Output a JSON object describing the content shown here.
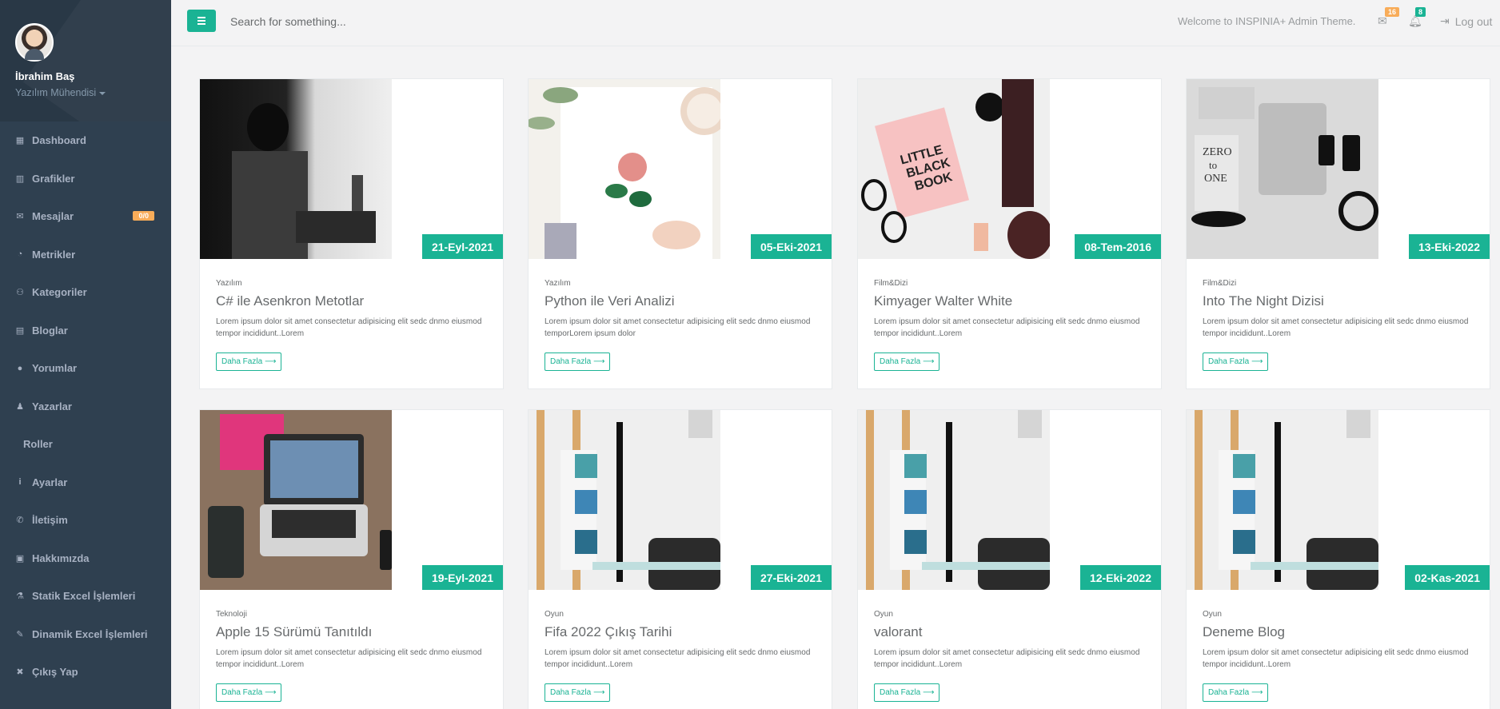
{
  "sidebar": {
    "profile": {
      "name": "İbrahim Baş",
      "role": "Yazılım Mühendisi"
    },
    "items": [
      {
        "label": "Dashboard",
        "icon": "dashboard-icon",
        "glyph": "▦"
      },
      {
        "label": "Grafikler",
        "icon": "bar-chart-icon",
        "glyph": "▥"
      },
      {
        "label": "Mesajlar",
        "icon": "envelope-icon",
        "glyph": "✉",
        "badge": "0/0"
      },
      {
        "label": "Metrikler",
        "icon": "pie-chart-icon",
        "glyph": "◔"
      },
      {
        "label": "Kategoriler",
        "icon": "users-icon",
        "glyph": "⚇"
      },
      {
        "label": "Bloglar",
        "icon": "list-alt-icon",
        "glyph": "▤"
      },
      {
        "label": "Yorumlar",
        "icon": "comment-icon",
        "glyph": "●"
      },
      {
        "label": "Yazarlar",
        "icon": "user-icon",
        "glyph": "♟"
      },
      {
        "label": "Roller",
        "icon": "",
        "glyph": ""
      },
      {
        "label": "Ayarlar",
        "icon": "info-icon",
        "glyph": "i"
      },
      {
        "label": "İletişim",
        "icon": "phone-icon",
        "glyph": "✆"
      },
      {
        "label": "Hakkımızda",
        "icon": "id-card-icon",
        "glyph": "▣"
      },
      {
        "label": "Statik Excel İşlemleri",
        "icon": "flask-icon",
        "glyph": "⚗"
      },
      {
        "label": "Dinamik Excel İşlemleri",
        "icon": "pencil-icon",
        "glyph": "✎"
      },
      {
        "label": "Çıkış Yap",
        "icon": "close-icon",
        "glyph": "✖"
      }
    ]
  },
  "topbar": {
    "search_placeholder": "Search for something...",
    "welcome": "Welcome to INSPINIA+ Admin Theme.",
    "mail_count": "16",
    "alert_count": "8",
    "logout": "Log out"
  },
  "cards": [
    {
      "date": "21-Eyl-2021",
      "category": "Yazılım",
      "title": "C# ile Asenkron Metotlar",
      "text": "Lorem ipsum dolor sit amet consectetur adipisicing elit sedc dnmo eiusmod tempor incididunt..Lorem",
      "button": "Daha Fazla"
    },
    {
      "date": "05-Eki-2021",
      "category": "Yazılım",
      "title": "Python ile Veri Analizi",
      "text": "Lorem ipsum dolor sit amet consectetur adipisicing elit sedc dnmo eiusmod temporLorem ipsum dolor",
      "button": "Daha Fazla"
    },
    {
      "date": "08-Tem-2016",
      "category": "Film&Dizi",
      "title": "Kimyager Walter White",
      "text": "Lorem ipsum dolor sit amet consectetur adipisicing elit sedc dnmo eiusmod tempor incididunt..Lorem",
      "button": "Daha Fazla"
    },
    {
      "date": "13-Eki-2022",
      "category": "Film&Dizi",
      "title": "Into The Night Dizisi",
      "text": "Lorem ipsum dolor sit amet consectetur adipisicing elit sedc dnmo eiusmod tempor incididunt..Lorem",
      "button": "Daha Fazla"
    },
    {
      "date": "19-Eyl-2021",
      "category": "Teknoloji",
      "title": "Apple 15 Sürümü Tanıtıldı",
      "text": "Lorem ipsum dolor sit amet consectetur adipisicing elit sedc dnmo eiusmod tempor incididunt..Lorem",
      "button": "Daha Fazla"
    },
    {
      "date": "27-Eki-2021",
      "category": "Oyun",
      "title": "Fifa 2022 Çıkış Tarihi",
      "text": "Lorem ipsum dolor sit amet consectetur adipisicing elit sedc dnmo eiusmod tempor incididunt..Lorem",
      "button": "Daha Fazla"
    },
    {
      "date": "12-Eki-2022",
      "category": "Oyun",
      "title": "valorant",
      "text": "Lorem ipsum dolor sit amet consectetur adipisicing elit sedc dnmo eiusmod tempor incididunt..Lorem",
      "button": "Daha Fazla"
    },
    {
      "date": "02-Kas-2021",
      "category": "Oyun",
      "title": "Deneme Blog",
      "text": "Lorem ipsum dolor sit amet consectetur adipisicing elit sedc dnmo eiusmod tempor incididunt..Lorem",
      "button": "Daha Fazla"
    }
  ],
  "colors": {
    "accent": "#1ab394",
    "sidebar": "#2f4050",
    "warning": "#f8ac59"
  }
}
